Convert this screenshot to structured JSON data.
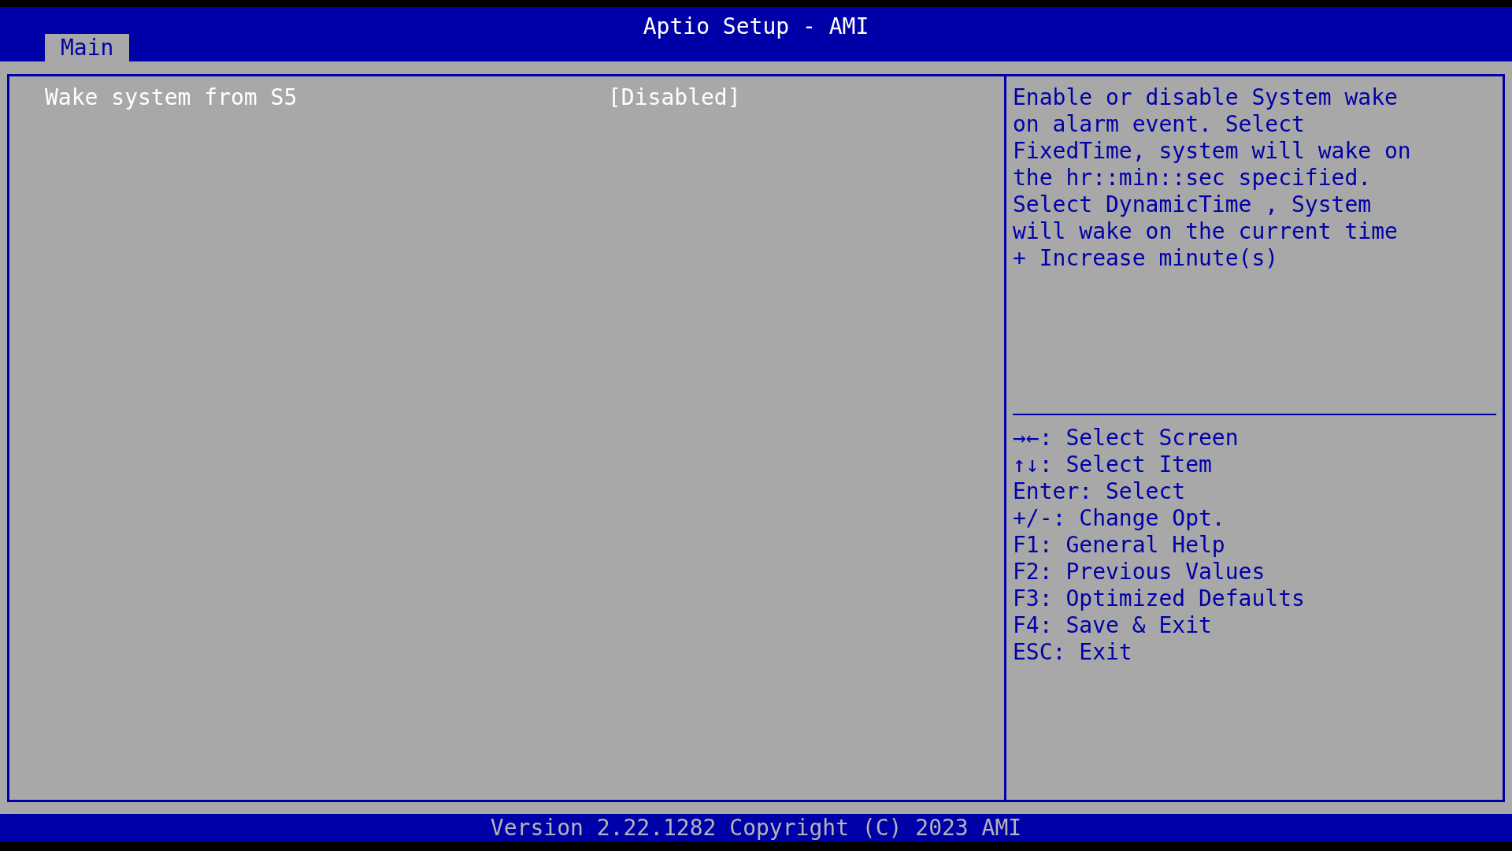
{
  "window": {
    "title": "Aptio Setup - AMI"
  },
  "tabs": [
    {
      "label": "Main",
      "selected": true
    }
  ],
  "settings": [
    {
      "label": "Wake system from S5",
      "value": "[Disabled]",
      "selected": true
    }
  ],
  "help_lines": [
    "Enable or disable System wake",
    "on alarm event. Select",
    "FixedTime, system will wake on",
    "the hr::min::sec specified.",
    "Select DynamicTime , System",
    "will wake on the current time",
    "+ Increase minute(s)"
  ],
  "key_hints": [
    "→←: Select Screen",
    "↑↓: Select Item",
    "Enter: Select",
    "+/-: Change Opt.",
    "F1: General Help",
    "F2: Previous Values",
    "F3: Optimized Defaults",
    "F4: Save & Exit",
    "ESC: Exit"
  ],
  "status_bar": "Version 2.22.1282 Copyright (C) 2023 AMI"
}
